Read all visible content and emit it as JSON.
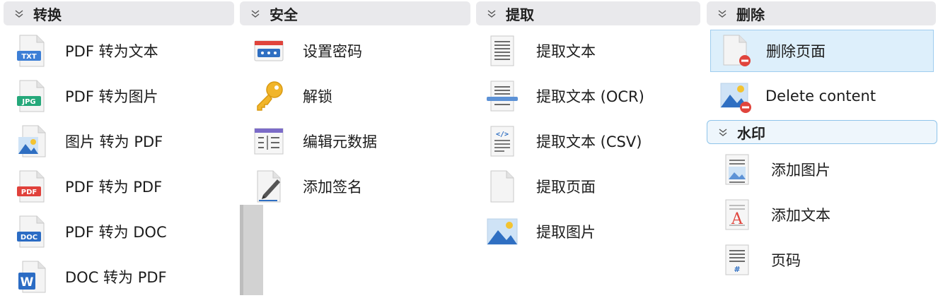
{
  "columns": [
    {
      "title": "转换",
      "items": [
        {
          "label": "PDF 转为文本",
          "icon": "txt-file-icon"
        },
        {
          "label": "PDF 转为图片",
          "icon": "jpg-file-icon"
        },
        {
          "label": "图片 转为 PDF",
          "icon": "image-file-icon"
        },
        {
          "label": "PDF 转为 PDF",
          "icon": "pdf-file-icon"
        },
        {
          "label": "PDF 转为 DOC",
          "icon": "doc-file-icon"
        },
        {
          "label": "DOC 转为 PDF",
          "icon": "word-file-icon"
        }
      ]
    },
    {
      "title": "安全",
      "items": [
        {
          "label": "设置密码",
          "icon": "password-icon"
        },
        {
          "label": "解锁",
          "icon": "key-icon"
        },
        {
          "label": "编辑元数据",
          "icon": "metadata-icon"
        },
        {
          "label": "添加签名",
          "icon": "signature-icon"
        }
      ]
    },
    {
      "title": "提取",
      "items": [
        {
          "label": "提取文本",
          "icon": "text-doc-icon"
        },
        {
          "label": "提取文本 (OCR)",
          "icon": "ocr-scan-icon"
        },
        {
          "label": "提取文本 (CSV)",
          "icon": "code-doc-icon"
        },
        {
          "label": "提取页面",
          "icon": "blank-page-icon"
        },
        {
          "label": "提取图片",
          "icon": "picture-icon"
        }
      ]
    },
    {
      "title": "删除",
      "items": [
        {
          "label": "删除页面",
          "icon": "delete-page-icon",
          "selected": true
        },
        {
          "label": "Delete content",
          "icon": "delete-image-icon"
        }
      ]
    },
    {
      "title": "水印",
      "items": [
        {
          "label": "添加图片",
          "icon": "watermark-image-icon"
        },
        {
          "label": "添加文本",
          "icon": "watermark-text-icon"
        },
        {
          "label": "页码",
          "icon": "page-number-icon"
        }
      ]
    }
  ]
}
